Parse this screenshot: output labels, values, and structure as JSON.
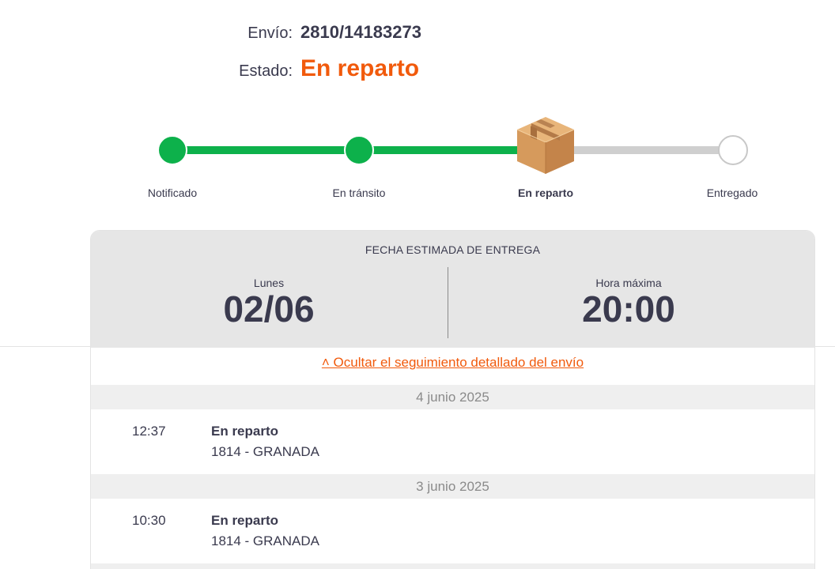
{
  "header": {
    "shipment_label": "Envío:",
    "shipment_value": "2810/14183273",
    "state_label": "Estado:",
    "state_value": "En reparto"
  },
  "progress": {
    "steps": [
      {
        "label": "Notificado",
        "status": "done"
      },
      {
        "label": "En tránsito",
        "status": "done"
      },
      {
        "label": "En reparto",
        "status": "current",
        "icon": "package-box-icon"
      },
      {
        "label": "Entregado",
        "status": "pending"
      }
    ]
  },
  "eta": {
    "title": "FECHA ESTIMADA DE ENTREGA",
    "day_label": "Lunes",
    "date": "02/06",
    "time_label": "Hora máxima",
    "time": "20:00"
  },
  "toggle_link": "˄ Ocultar el seguimiento detallado del envío",
  "tracking": [
    {
      "date": "4 junio 2025",
      "events": [
        {
          "time": "12:37",
          "title": "En reparto",
          "place": "1814 - GRANADA"
        }
      ]
    },
    {
      "date": "3 junio 2025",
      "events": [
        {
          "time": "10:30",
          "title": "En reparto",
          "place": "1814 - GRANADA"
        }
      ]
    }
  ],
  "colors": {
    "accent_orange": "#f15a0c",
    "done_green": "#0db14b",
    "pending_gray": "#cfcfcf",
    "text_dark": "#3a3a4e"
  }
}
